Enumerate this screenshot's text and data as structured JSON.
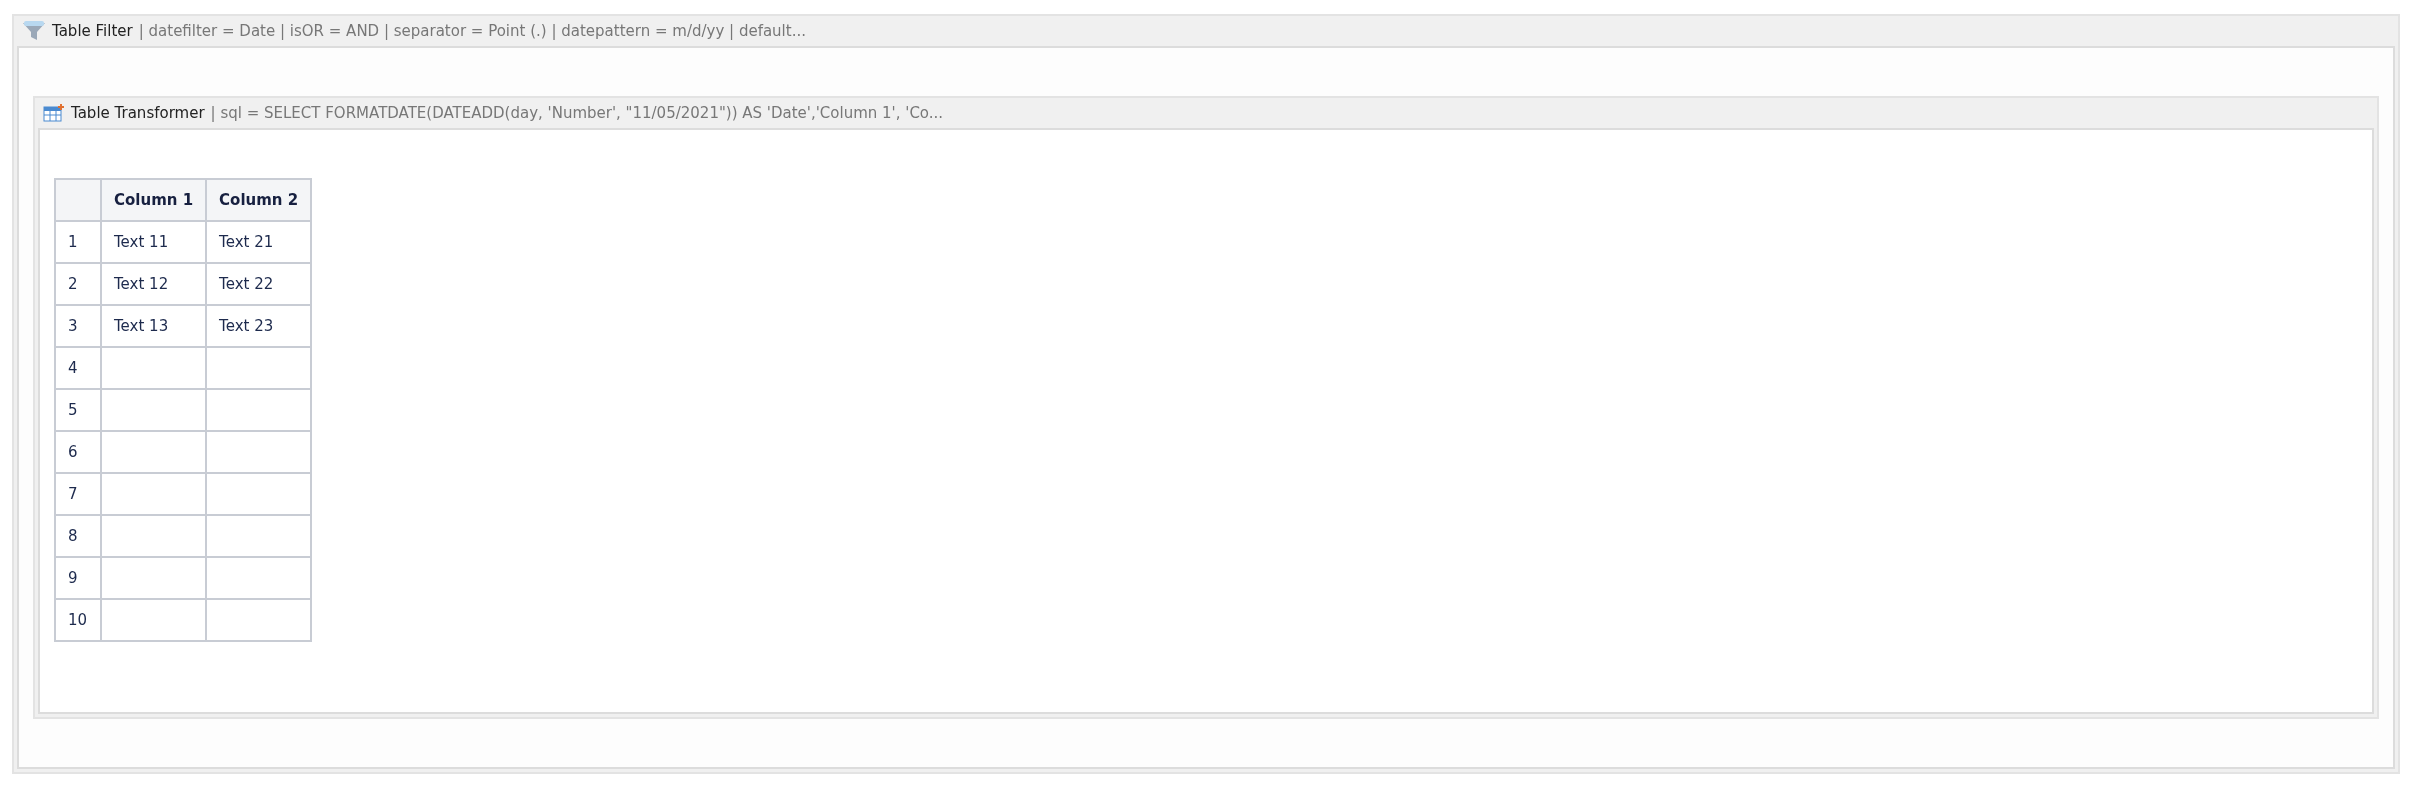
{
  "filter_panel": {
    "title": "Table Filter",
    "details": "| datefilter = Date | isOR = AND | separator = Point (.) | datepattern = m/d/yy | default..."
  },
  "transformer_panel": {
    "title": "Table Transformer",
    "details": "| sql = SELECT FORMATDATE(DATEADD(day, 'Number', \"11/05/2021\")) AS 'Date','Column 1', 'Co..."
  },
  "table": {
    "columns": [
      "Column 1",
      "Column 2"
    ],
    "rows": [
      {
        "number": "1",
        "cells": [
          "Text 11",
          "Text 21"
        ]
      },
      {
        "number": "2",
        "cells": [
          "Text 12",
          "Text 22"
        ]
      },
      {
        "number": "3",
        "cells": [
          "Text 13",
          "Text 23"
        ]
      },
      {
        "number": "4",
        "cells": []
      },
      {
        "number": "5",
        "cells": []
      },
      {
        "number": "6",
        "cells": []
      },
      {
        "number": "7",
        "cells": []
      },
      {
        "number": "8",
        "cells": []
      },
      {
        "number": "9",
        "cells": []
      },
      {
        "number": "10",
        "cells": []
      }
    ]
  }
}
